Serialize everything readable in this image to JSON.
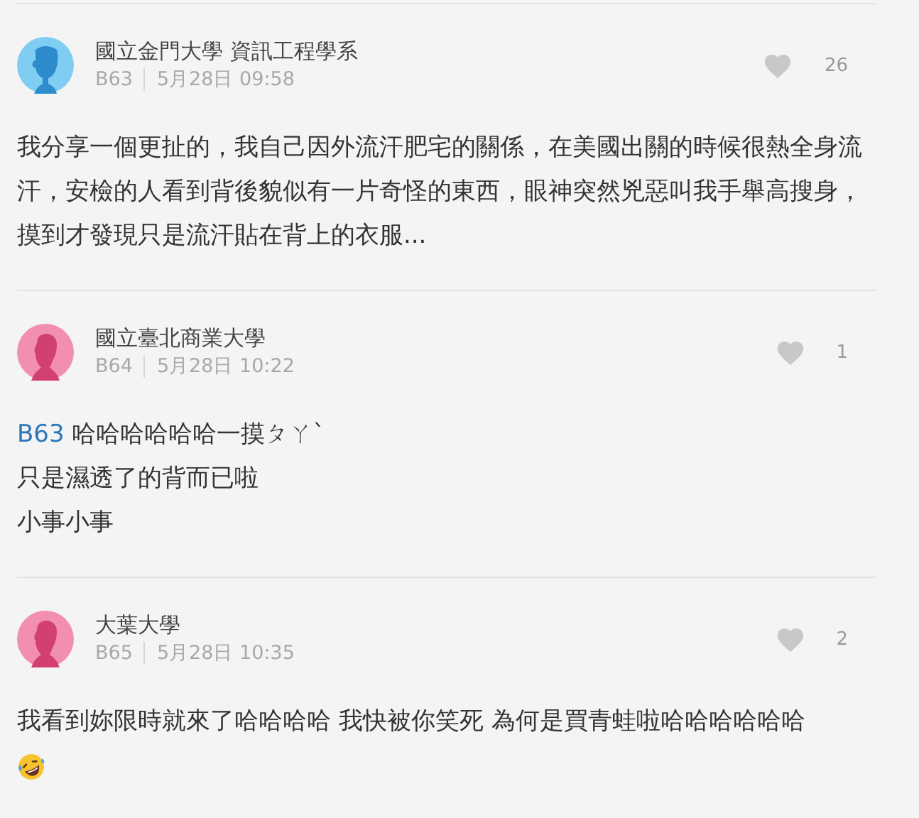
{
  "comments": [
    {
      "author": "國立金門大學 資訊工程學系",
      "kind": "male",
      "floor": "B63",
      "time": "5月28日 09:58",
      "liked": false,
      "likes": "26",
      "paragraphs": [
        "我分享一個更扯的，我自己因外流汗肥宅的關係，在美國出關的時候很熱全身流汗，安檢的人看到背後貌似有一片奇怪的東西，眼神突然兇惡叫我手舉高搜身，摸到才發現只是流汗貼在背上的衣服..."
      ]
    },
    {
      "author": "國立臺北商業大學",
      "kind": "female",
      "floor": "B64",
      "time": "5月28日 10:22",
      "liked": false,
      "likes": "1",
      "mention": "B63",
      "paragraphs": [
        "哈哈哈哈哈哈一摸ㄆㄚ`",
        "只是濕透了的背而已啦",
        "小事小事"
      ]
    },
    {
      "author": "大葉大學",
      "kind": "female",
      "floor": "B65",
      "time": "5月28日 10:35",
      "liked": false,
      "likes": "2",
      "paragraphs": [
        "我看到妳限時就來了哈哈哈哈 我快被你笑死 為何是買青蛙啦哈哈哈哈哈哈"
      ],
      "trailing_emoji": true
    }
  ]
}
